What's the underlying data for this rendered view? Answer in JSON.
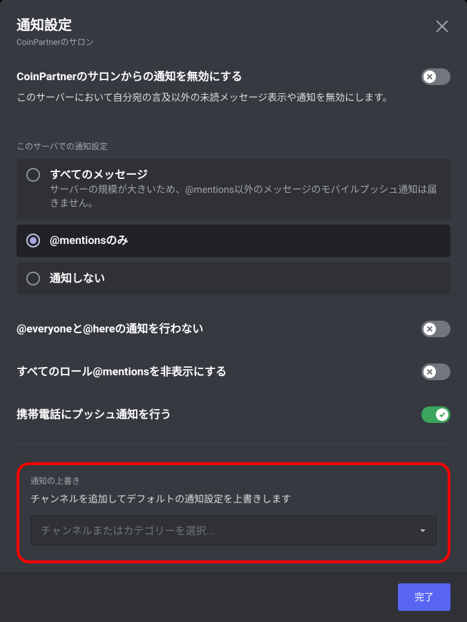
{
  "header": {
    "title": "通知設定",
    "subtitle": "CoinPartnerのサロン"
  },
  "mute": {
    "title": "CoinPartnerのサロンからの通知を無効にする",
    "desc": "このサーバーにおいて自分宛の言及以外の未読メッセージ表示や通知を無効にします。"
  },
  "serverNotifLabel": "このサーバでの通知設定",
  "radios": {
    "all": {
      "title": "すべてのメッセージ",
      "desc": "サーバーの規模が大きいため、@mentions以外のメッセージのモバイルプッシュ通知は届きません。"
    },
    "mentions": {
      "title": "@mentionsのみ"
    },
    "none": {
      "title": "通知しない"
    }
  },
  "toggles": {
    "everyone": "@everyoneと@hereの通知を行わない",
    "roles": "すべてのロール@mentionsを非表示にする",
    "push": "携帯電話にプッシュ通知を行う"
  },
  "override": {
    "title": "通知の上書き",
    "sub": "チャンネルを追加してデフォルトの通知設定を上書きします",
    "placeholder": "チャンネルまたはカテゴリーを選択..."
  },
  "footer": {
    "done": "完了"
  }
}
